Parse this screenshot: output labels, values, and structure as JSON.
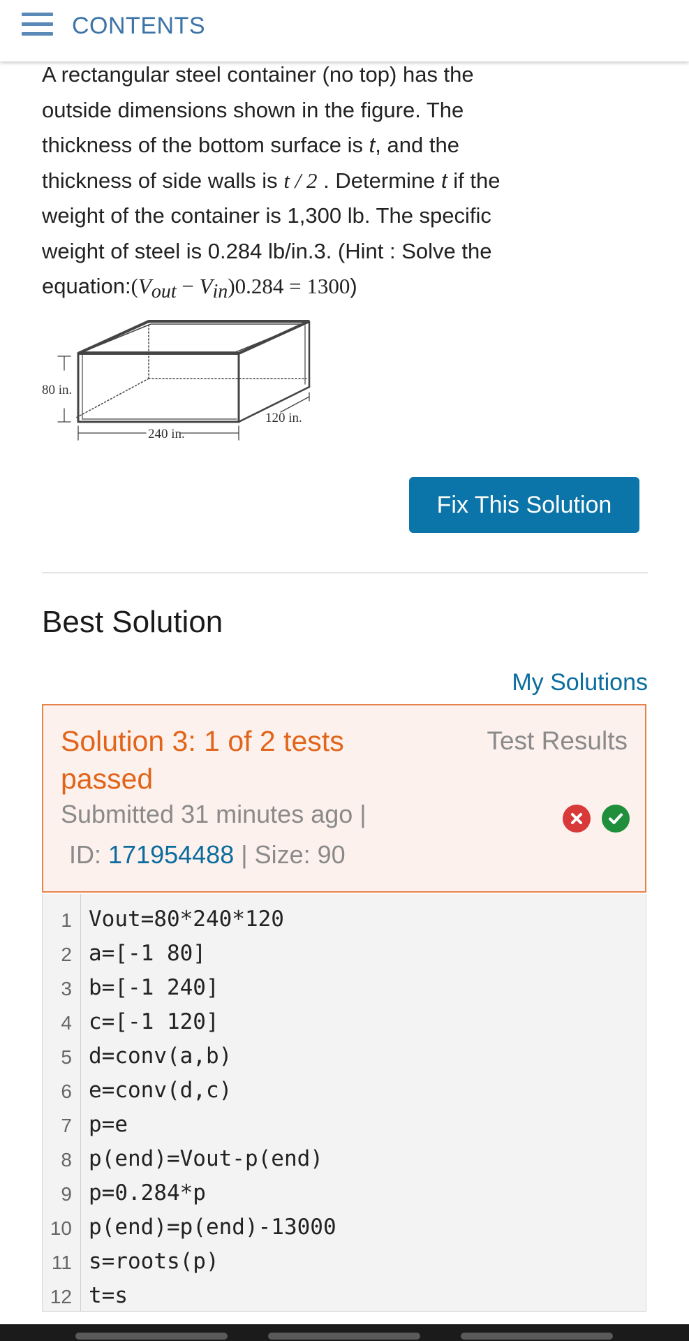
{
  "header": {
    "title": "CONTENTS"
  },
  "problem": {
    "l1": "A rectangular steel container (no top) has the",
    "l2": "outside dimensions shown in the figure. The",
    "l3_a": "thickness of the bottom surface is ",
    "l3_t": "t",
    "l3_b": ", and the",
    "l4_a": "thickness of side walls is ",
    "l4_math": "t / 2",
    "l4_b": " . Determine ",
    "l4_t": "t",
    "l4_c": " if the",
    "l5": "weight of the container is 1,300 lb. The specific",
    "l6": "weight of steel is 0.284 lb/in.3. (Hint : Solve the",
    "l7_a": "equation:",
    "l7_open": "(",
    "l7_v1": "V",
    "l7_s1": "out",
    "l7_minus": " − ",
    "l7_v2": "V",
    "l7_s2": "in",
    "l7_rest": ")0.284 = 1300",
    "l7_close": ")"
  },
  "figure": {
    "height_label": "80 in.",
    "width_label": "240 in.",
    "depth_label": "120 in."
  },
  "fix_button": "Fix This Solution",
  "best_heading": "Best Solution",
  "my_solutions": "My Solutions",
  "result": {
    "title": "Solution 3: 1 of 2 tests passed",
    "test_results": "Test Results",
    "submitted": "Submitted 31 minutes ago  |",
    "id_label": "ID: ",
    "id_value": "171954488",
    "sep": "  |  ",
    "size": "Size: 90",
    "tests": [
      {
        "status": "fail",
        "icon": "x-icon"
      },
      {
        "status": "pass",
        "icon": "check-icon"
      }
    ],
    "colors": {
      "fail": "#d83a3a",
      "pass": "#1f8f3b",
      "accent": "#e0651a"
    }
  },
  "code_lines": [
    {
      "n": "1",
      "src": "Vout=80*240*120"
    },
    {
      "n": "2",
      "src": "a=[-1 80]"
    },
    {
      "n": "3",
      "src": "b=[-1 240]"
    },
    {
      "n": "4",
      "src": "c=[-1 120]"
    },
    {
      "n": "5",
      "src": "d=conv(a,b)"
    },
    {
      "n": "6",
      "src": "e=conv(d,c)"
    },
    {
      "n": "7",
      "src": "p=e"
    },
    {
      "n": "8",
      "src": "p(end)=Vout-p(end)"
    },
    {
      "n": "9",
      "src": "p=0.284*p"
    },
    {
      "n": "10",
      "src": "p(end)=p(end)-13000"
    },
    {
      "n": "11",
      "src": "s=roots(p)"
    },
    {
      "n": "12",
      "src": "t=s"
    }
  ]
}
